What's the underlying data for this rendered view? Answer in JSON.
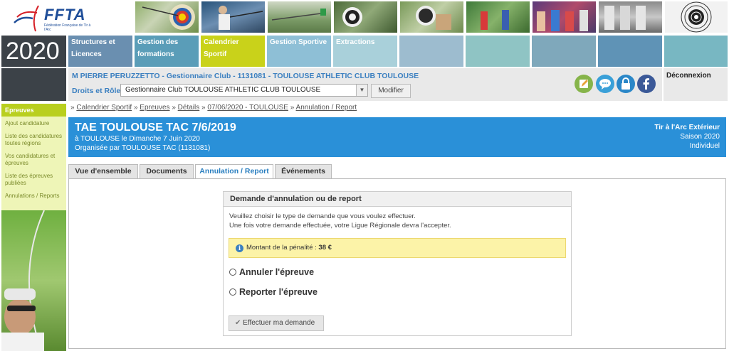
{
  "header": {
    "logo_text": "FFTA",
    "logo_subtitle": "Fédération Française de Tir à l'Arc",
    "year": "2020"
  },
  "nav": {
    "items": [
      {
        "label": "Structures et Licences",
        "color": "#6a8fb0"
      },
      {
        "label": "Gestion des formations",
        "color": "#5a9db8"
      },
      {
        "label": "Calendrier Sportif",
        "color": "#c9d21a"
      },
      {
        "label": "Gestion Sportive",
        "color": "#8ebfd6"
      },
      {
        "label": "Extractions",
        "color": "#a9d0da"
      },
      {
        "label": "",
        "color": "#9dbccf"
      },
      {
        "label": "",
        "color": "#8fc4c4"
      },
      {
        "label": "",
        "color": "#7fa8bb"
      },
      {
        "label": "",
        "color": "#5f93b6"
      },
      {
        "label": "",
        "color": "#78b7c2"
      }
    ]
  },
  "user": {
    "line": "M PIERRE PERUZZETTO - Gestionnaire Club - 1131081 - TOULOUSE ATHLETIC CLUB TOULOUSE",
    "role_label": "Droits et Rôle :",
    "role_value": "Gestionnaire Club TOULOUSE ATHLETIC CLUB TOULOUSE",
    "modify_label": "Modifier",
    "logout_label": "Déconnexion"
  },
  "sidebar": {
    "heading": "Epreuves",
    "items": [
      "Ajout candidature",
      "Liste des candidatures toutes régions",
      "Vos candidatures et épreuves",
      "Liste des épreuves publiées",
      "Annulations / Reports"
    ]
  },
  "breadcrumb": {
    "prefix": "»",
    "items": [
      "Calendrier Sportif",
      "Epreuves",
      "Détails",
      "07/06/2020 - TOULOUSE",
      "Annulation / Report"
    ],
    "sep": "»"
  },
  "event": {
    "title": "TAE TOULOUSE TAC 7/6/2019",
    "line1": "à TOULOUSE le Dimanche 7 Juin 2020",
    "line2": "Organisée par TOULOUSE TAC (1131081)",
    "discipline": "Tir à l'Arc Extérieur",
    "season": "Saison 2020",
    "type": "Individuel"
  },
  "tabs": [
    {
      "label": "Vue d'ensemble",
      "active": false
    },
    {
      "label": "Documents",
      "active": false
    },
    {
      "label": "Annulation / Report",
      "active": true
    },
    {
      "label": "Événements",
      "active": false
    }
  ],
  "request": {
    "heading": "Demande d'annulation ou de report",
    "intro1": "Veuillez choisir le type de demande que vous voulez effectuer.",
    "intro2": "Une fois votre demande effectuée, votre Ligue Régionale devra l'accepter.",
    "penalty_label": "Montant de la pénalité :",
    "penalty_value": "38 €",
    "option_cancel": "Annuler l'épreuve",
    "option_postpone": "Reporter l'épreuve",
    "submit_label": "Effectuer ma demande"
  },
  "icons": [
    "edit-icon",
    "chat-icon",
    "lock-icon",
    "facebook-icon",
    "info-icon",
    "check-icon",
    "chevron-down-icon"
  ]
}
